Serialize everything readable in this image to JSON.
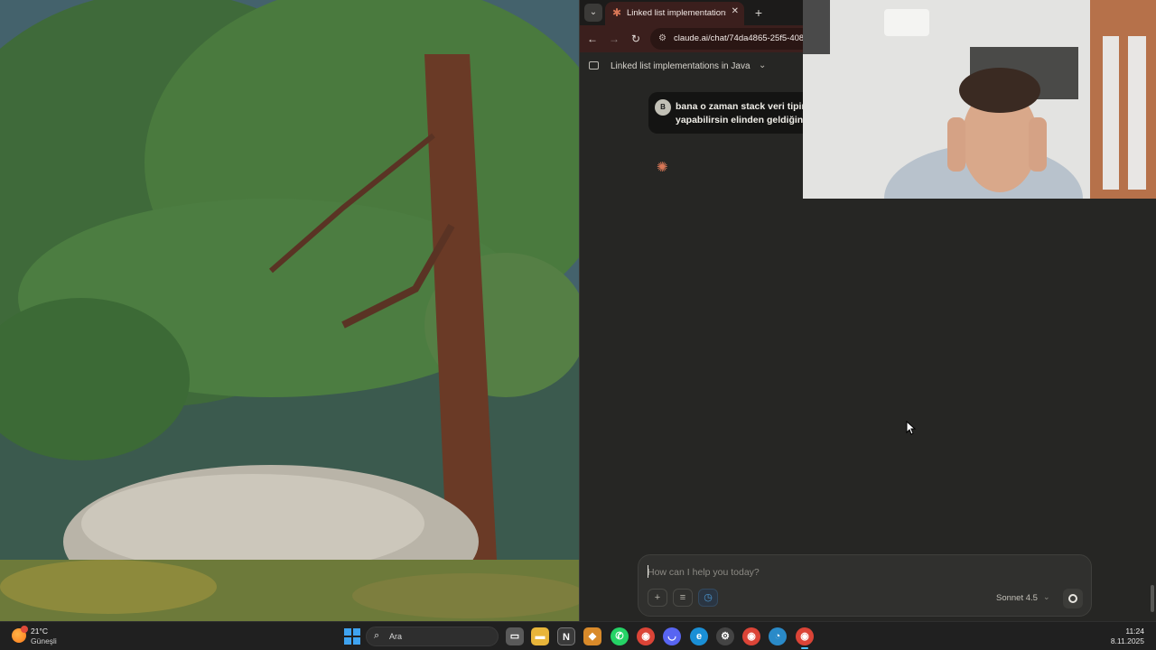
{
  "browser": {
    "tab_title": "Linked list implementations in J",
    "address": "claude.ai/chat/74da4865-25f5-408",
    "conversation_title": "Linked list implementations in Java"
  },
  "chat": {
    "user_initial": "B",
    "user_message_line1": "bana o zaman stack veri tipin",
    "user_message_line2": "yapabilirsin elinden geldiğini"
  },
  "composer": {
    "placeholder": "How can I help you today?",
    "model": "Sonnet 4.5"
  },
  "taskbar": {
    "weather_temp": "21°C",
    "weather_condition": "Güneşli",
    "search_label": "Ara",
    "time": "11:24",
    "date": "8.11.2025"
  },
  "colors": {
    "accent": "#d97757",
    "browser_tab_bg": "#3b1f1d",
    "page_bg": "#262624"
  }
}
